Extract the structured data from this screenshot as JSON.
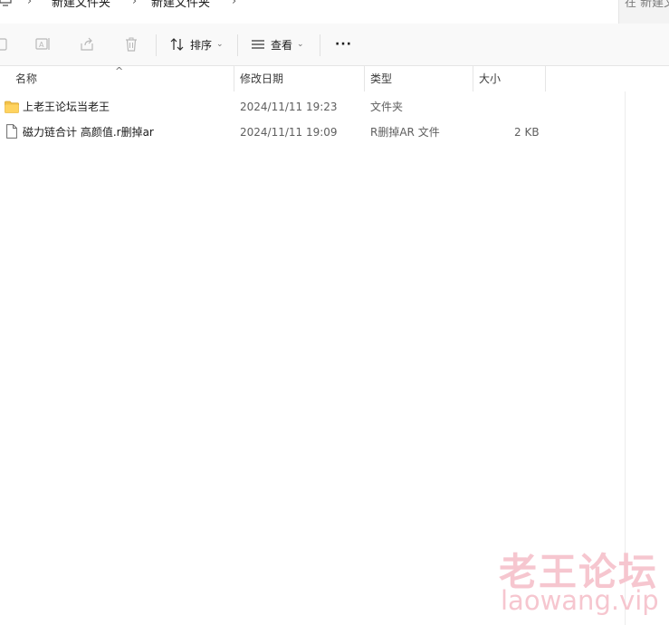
{
  "breadcrumb": {
    "items": [
      "新建文件夹",
      "新建文件夹"
    ],
    "search_placeholder": "在 新建文"
  },
  "toolbar": {
    "sort_label": "排序",
    "view_label": "查看",
    "more_label": "···"
  },
  "columns": {
    "name": "名称",
    "modified": "修改日期",
    "type": "类型",
    "size": "大小"
  },
  "files": [
    {
      "name": "上老王论坛当老王",
      "modified": "2024/11/11 19:23",
      "type": "文件夹",
      "size": "",
      "icon": "folder-icon"
    },
    {
      "name": "磁力链合计 高颜值.r删掉ar",
      "modified": "2024/11/11 19:09",
      "type": "R删掉AR 文件",
      "size": "2 KB",
      "icon": "file-icon"
    }
  ],
  "watermark": {
    "cn": "老王论坛",
    "url": "laowang.vip"
  }
}
